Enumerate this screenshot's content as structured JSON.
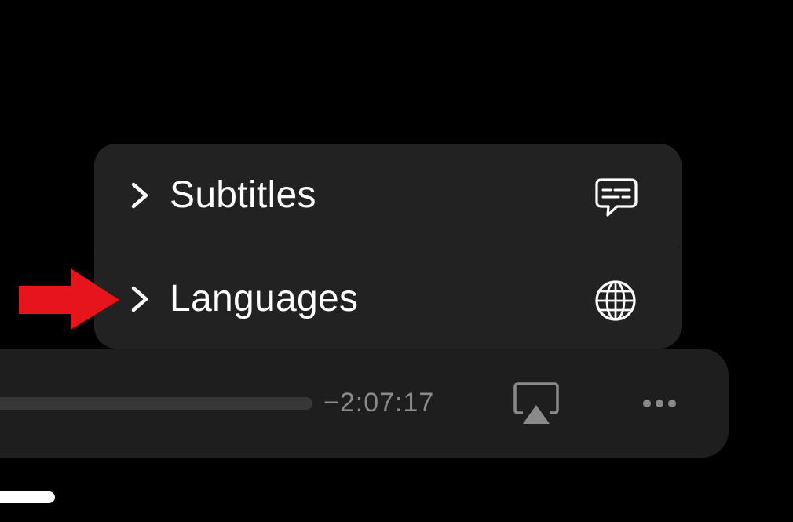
{
  "menu": {
    "items": [
      {
        "label": "Subtitles",
        "chevron_icon": "chevron-right-icon",
        "icon": "subtitles-speech-bubble-icon"
      },
      {
        "label": "Languages",
        "chevron_icon": "chevron-right-icon",
        "icon": "globe-icon"
      }
    ]
  },
  "player": {
    "time_remaining": "−2:07:17",
    "airplay_icon": "airplay-icon",
    "more_icon": "more-ellipsis-icon"
  },
  "annotation": {
    "arrow_icon": "red-arrow-icon",
    "arrow_color": "#e8141b"
  },
  "colors": {
    "background": "#000000",
    "menu_background": "#222222",
    "player_bar_background": "#1e1e1e",
    "text_primary": "#ffffff",
    "text_secondary": "#8a8a8a"
  }
}
